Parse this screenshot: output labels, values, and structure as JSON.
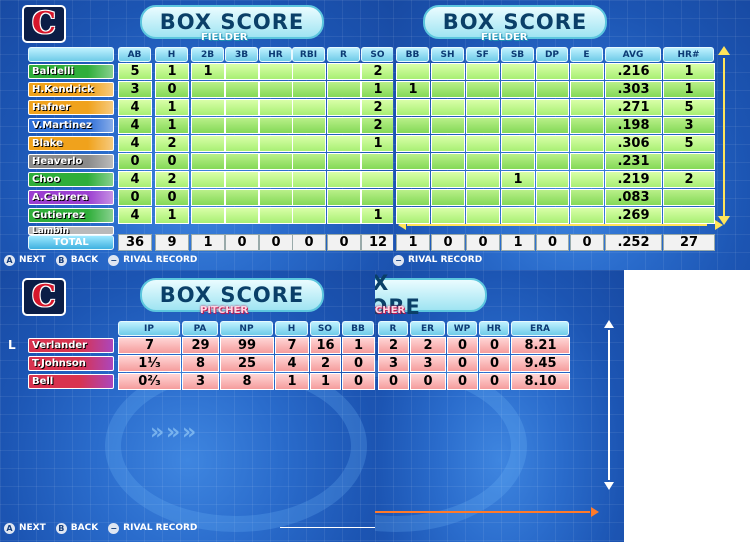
{
  "screen_title": "BOX SCORE",
  "team_logo": "C",
  "fielder_label": "FIELDER",
  "pitcher_label": "PITCHER",
  "fielder_columns_left": [
    "AB",
    "H",
    "2B",
    "3B",
    "HR",
    "RBI",
    "R",
    "SO"
  ],
  "fielder_columns_right": [
    "BB",
    "SH",
    "SF",
    "SB",
    "DP",
    "E",
    "AVG",
    "HR#"
  ],
  "fielders": [
    {
      "name": "Baldelli",
      "color": "#2fae3a",
      "left": [
        "5",
        "1",
        "1",
        "",
        "",
        "",
        "",
        "2"
      ],
      "right": [
        "",
        "",
        "",
        "",
        "",
        "",
        ".216",
        "1"
      ]
    },
    {
      "name": "H.Kendrick",
      "color": "#f0a21c",
      "left": [
        "3",
        "0",
        "",
        "",
        "",
        "",
        "",
        "1"
      ],
      "right": [
        "1",
        "",
        "",
        "",
        "",
        "",
        ".303",
        "1"
      ]
    },
    {
      "name": "Hafner",
      "color": "#f0a21c",
      "left": [
        "4",
        "1",
        "",
        "",
        "",
        "",
        "",
        "2"
      ],
      "right": [
        "",
        "",
        "",
        "",
        "",
        "",
        ".271",
        "5"
      ]
    },
    {
      "name": "V.Martinez",
      "color": "#2f6fd8",
      "left": [
        "4",
        "1",
        "",
        "",
        "",
        "",
        "",
        "2"
      ],
      "right": [
        "",
        "",
        "",
        "",
        "",
        "",
        ".198",
        "3"
      ]
    },
    {
      "name": "Blake",
      "color": "#f0a21c",
      "left": [
        "4",
        "2",
        "",
        "",
        "",
        "",
        "",
        "1"
      ],
      "right": [
        "",
        "",
        "",
        "",
        "",
        "",
        ".306",
        "5"
      ]
    },
    {
      "name": "Heaverlo",
      "color": "#8a8a8a",
      "left": [
        "0",
        "0",
        "",
        "",
        "",
        "",
        "",
        ""
      ],
      "right": [
        "",
        "",
        "",
        "",
        "",
        "",
        ".231",
        ""
      ]
    },
    {
      "name": "Choo",
      "color": "#2fae3a",
      "left": [
        "4",
        "2",
        "",
        "",
        "",
        "",
        "",
        ""
      ],
      "right": [
        "",
        "",
        "",
        "1",
        "",
        "",
        ".219",
        "2"
      ]
    },
    {
      "name": "A.Cabrera",
      "color": "#9b3fd0",
      "left": [
        "0",
        "0",
        "",
        "",
        "",
        "",
        "",
        ""
      ],
      "right": [
        "",
        "",
        "",
        "",
        "",
        "",
        ".083",
        ""
      ]
    },
    {
      "name": "Gutierrez",
      "color": "#2fae3a",
      "left": [
        "4",
        "1",
        "",
        "",
        "",
        "",
        "",
        "1"
      ],
      "right": [
        "",
        "",
        "",
        "",
        "",
        "",
        ".269",
        ""
      ]
    }
  ],
  "partial_row_name": "Lambin",
  "total_label": "TOTAL",
  "totals_left": [
    "36",
    "9",
    "1",
    "0",
    "0",
    "0",
    "0",
    "12"
  ],
  "totals_right": [
    "1",
    "0",
    "0",
    "1",
    "0",
    "0",
    ".252",
    "27"
  ],
  "pitcher_columns_left": [
    "IP",
    "PA",
    "NP",
    "H",
    "SO",
    "BB"
  ],
  "pitcher_columns_right": [
    "R",
    "ER",
    "WP",
    "HR",
    "ERA"
  ],
  "pitchers": [
    {
      "flag": "L",
      "name": "Verlander",
      "left": [
        "7",
        "29",
        "99",
        "7",
        "16",
        "1"
      ],
      "right": [
        "2",
        "2",
        "0",
        "0",
        "8.21"
      ]
    },
    {
      "flag": "",
      "name": "T.Johnson",
      "left": [
        "1¹⁄₃",
        "8",
        "25",
        "4",
        "2",
        "0"
      ],
      "right": [
        "3",
        "3",
        "0",
        "0",
        "9.45"
      ]
    },
    {
      "flag": "",
      "name": "Bell",
      "left": [
        "0²⁄₃",
        "3",
        "8",
        "1",
        "1",
        "0"
      ],
      "right": [
        "0",
        "0",
        "0",
        "0",
        "8.10"
      ]
    }
  ],
  "controls": [
    {
      "button": "A",
      "label": "NEXT"
    },
    {
      "button": "B",
      "label": "BACK"
    },
    {
      "button": "−",
      "label": "RIVAL RECORD"
    }
  ],
  "colors": {
    "accent_green": "#a8ef74",
    "accent_pink": "#f59c9c",
    "panel_blue": "#1c55b3",
    "scroll_orange": "#ff7a2a"
  }
}
